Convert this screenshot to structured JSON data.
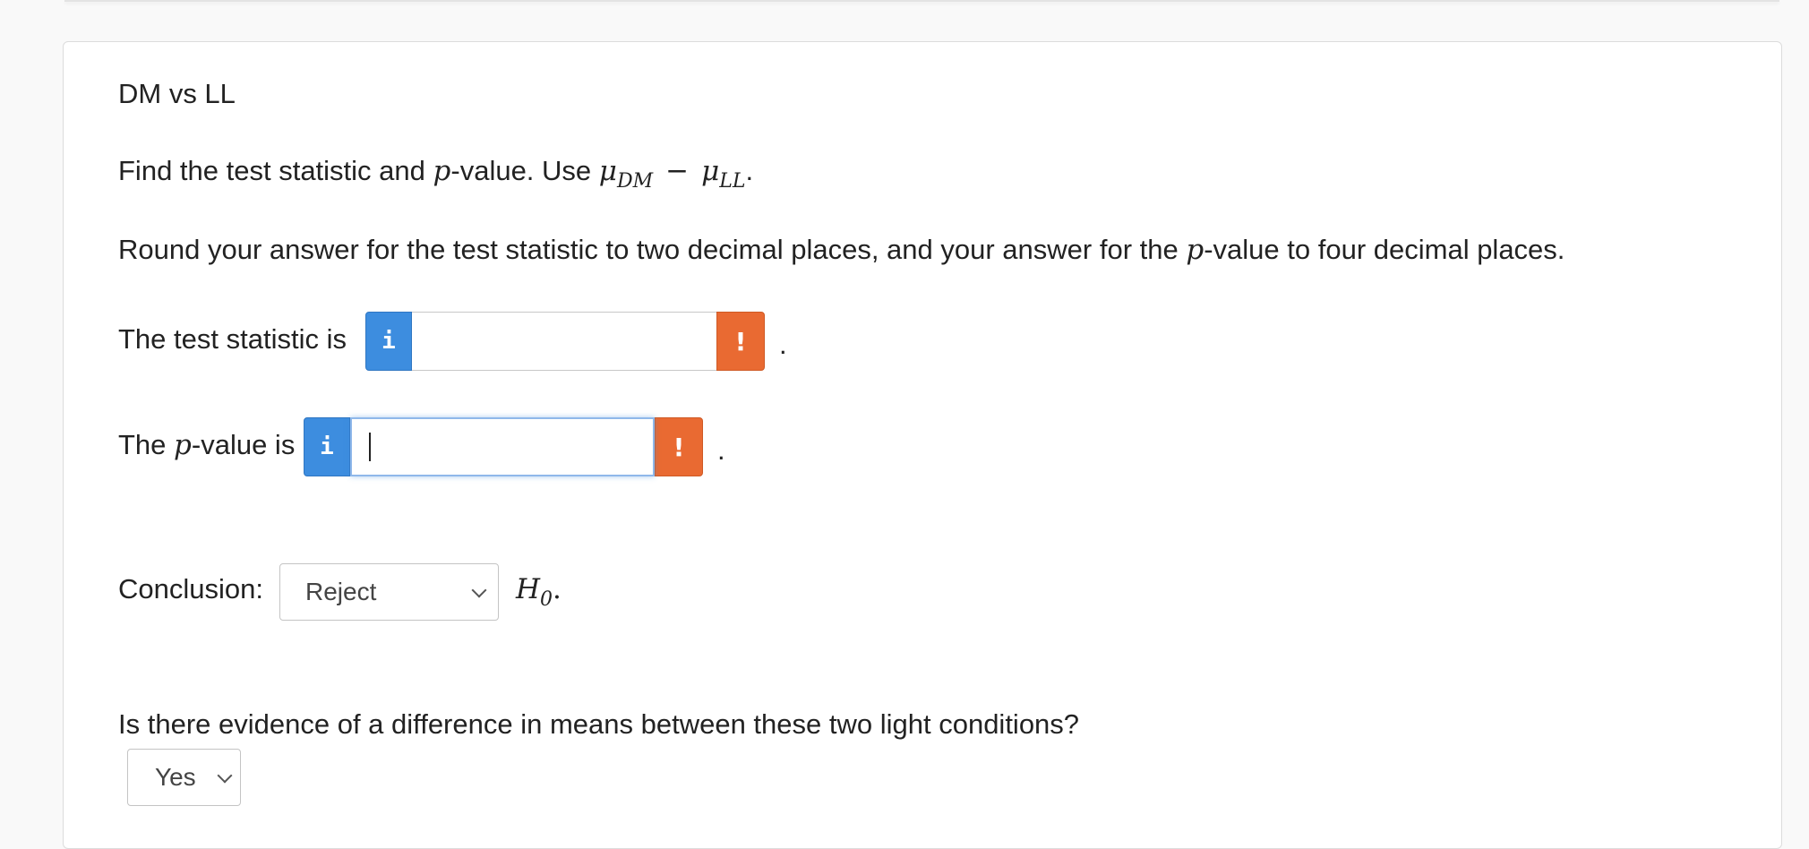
{
  "question": {
    "title": "DM vs LL",
    "prompt_prefix": "Find the test statistic and ",
    "p_symbol": "p",
    "prompt_mid": "-value. Use ",
    "mu": "μ",
    "sub_dm": "DM",
    "minus": "−",
    "sub_ll": "LL",
    "period": ".",
    "rounding_part1": "Round your answer for the test statistic to two decimal places, and your answer for the ",
    "rounding_part2": "-value to four decimal places."
  },
  "test_statistic": {
    "label": "The test statistic is",
    "info_icon": "i",
    "value": "",
    "warn_icon": "!",
    "suffix": "."
  },
  "p_value": {
    "label_prefix": "The ",
    "label_suffix": "-value is",
    "info_icon": "i",
    "value": "",
    "warn_icon": "!",
    "suffix": "."
  },
  "conclusion": {
    "label": "Conclusion:",
    "selected": "Reject",
    "h": "H",
    "h_sub": "0",
    "suffix": "."
  },
  "evidence": {
    "question": "Is there evidence of a difference in means between these two light conditions?",
    "selected": "Yes"
  },
  "colors": {
    "info_blue": "#3d8ddf",
    "warn_orange": "#e96a32"
  }
}
